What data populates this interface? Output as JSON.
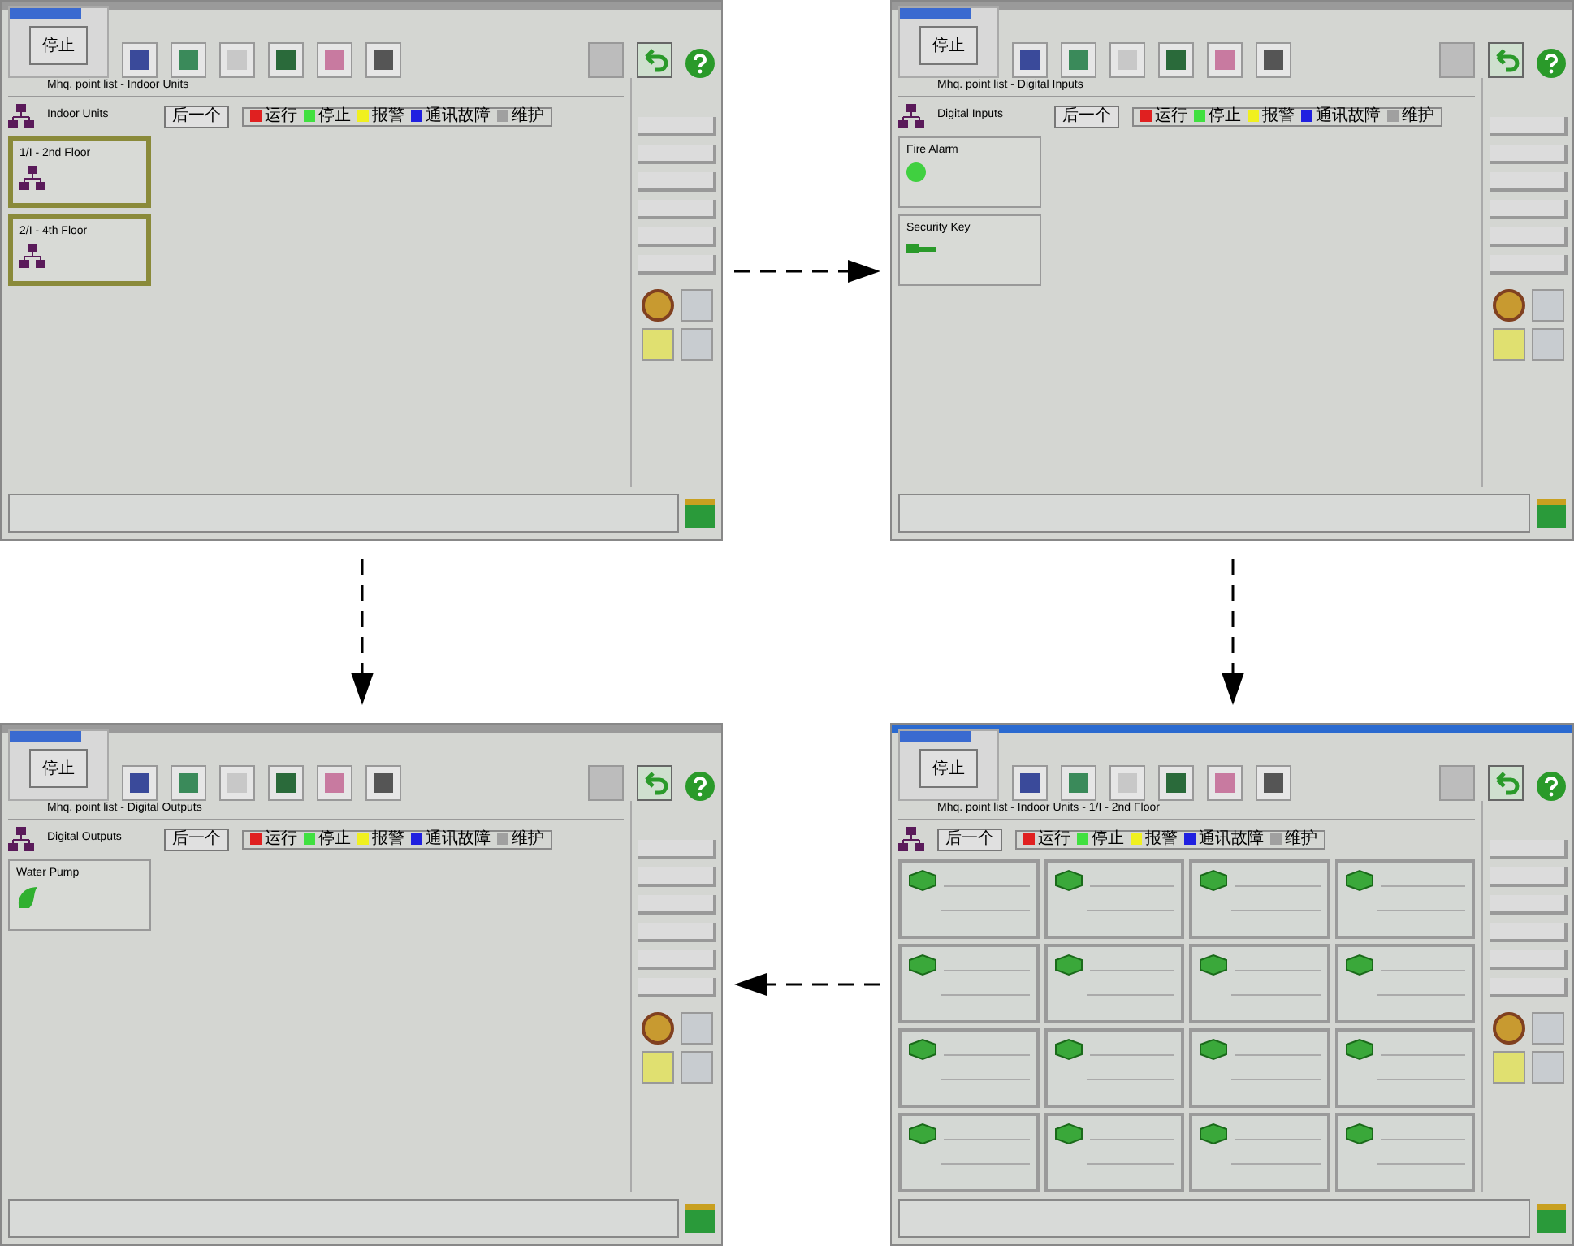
{
  "screens": [
    {
      "kind": "list",
      "stop_button": "停止",
      "breadcrumb": "Mhq. point list - Indoor Units",
      "tree_label": "Indoor Units",
      "next_button": "后一个",
      "legend": [
        {
          "label": "运行",
          "color": "#e02020"
        },
        {
          "label": "停止",
          "color": "#40e040"
        },
        {
          "label": "报警",
          "color": "#f0f020"
        },
        {
          "label": "通讯故障",
          "color": "#2020e0"
        },
        {
          "label": "维护",
          "color": "#a0a0a0"
        }
      ],
      "cards": [
        {
          "kind": "group",
          "title": "1/I - 2nd Floor"
        },
        {
          "kind": "group",
          "title": "2/I - 4th Floor"
        }
      ]
    },
    {
      "kind": "list",
      "stop_button": "停止",
      "breadcrumb": "Mhq. point list - Digital Inputs",
      "tree_label": "Digital Inputs",
      "next_button": "后一个",
      "legend": [
        {
          "label": "运行",
          "color": "#e02020"
        },
        {
          "label": "停止",
          "color": "#40e040"
        },
        {
          "label": "报警",
          "color": "#f0f020"
        },
        {
          "label": "通讯故障",
          "color": "#2020e0"
        },
        {
          "label": "维护",
          "color": "#a0a0a0"
        }
      ],
      "cards": [
        {
          "kind": "input",
          "title": "Fire Alarm"
        },
        {
          "kind": "key",
          "title": "Security Key"
        }
      ]
    },
    {
      "kind": "list",
      "stop_button": "停止",
      "breadcrumb": "Mhq. point list - Digital Outputs",
      "tree_label": "Digital Outputs",
      "next_button": "后一个",
      "legend": [
        {
          "label": "运行",
          "color": "#e02020"
        },
        {
          "label": "停止",
          "color": "#40e040"
        },
        {
          "label": "报警",
          "color": "#f0f020"
        },
        {
          "label": "通讯故障",
          "color": "#2020e0"
        },
        {
          "label": "维护",
          "color": "#a0a0a0"
        }
      ],
      "cards": [
        {
          "kind": "output",
          "title": "Water Pump"
        }
      ]
    },
    {
      "kind": "grid",
      "stop_button": "停止",
      "breadcrumb": "Mhq. point list - Indoor Units - 1/I - 2nd Floor",
      "next_button": "后一个",
      "legend": [
        {
          "label": "运行",
          "color": "#e02020"
        },
        {
          "label": "停止",
          "color": "#40e040"
        },
        {
          "label": "报警",
          "color": "#f0f020"
        },
        {
          "label": "通讯故障",
          "color": "#2020e0"
        },
        {
          "label": "维护",
          "color": "#a0a0a0"
        }
      ],
      "cards": [
        {
          "kind": "unit"
        },
        {
          "kind": "unit"
        },
        {
          "kind": "unit"
        },
        {
          "kind": "unit"
        },
        {
          "kind": "unit"
        },
        {
          "kind": "unit"
        },
        {
          "kind": "unit"
        },
        {
          "kind": "unit"
        },
        {
          "kind": "unit"
        },
        {
          "kind": "unit"
        },
        {
          "kind": "unit"
        },
        {
          "kind": "unit"
        },
        {
          "kind": "unit"
        },
        {
          "kind": "unit"
        },
        {
          "kind": "unit"
        },
        {
          "kind": "unit"
        }
      ]
    }
  ]
}
